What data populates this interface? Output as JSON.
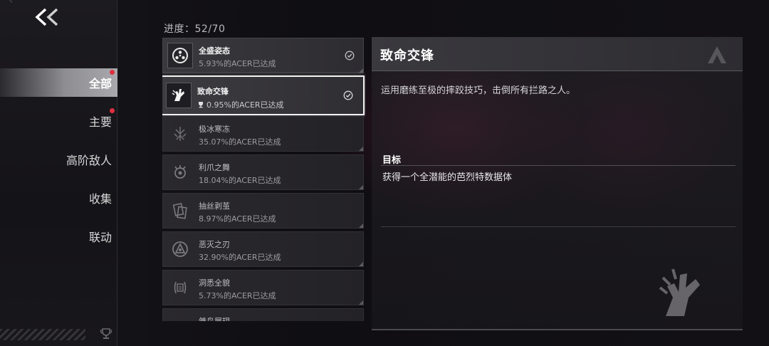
{
  "sidebar": {
    "items": [
      {
        "label": "全部",
        "active": true,
        "dot": true
      },
      {
        "label": "主要",
        "active": false,
        "dot": true
      },
      {
        "label": "高阶敌人",
        "active": false,
        "dot": false
      },
      {
        "label": "收集",
        "active": false,
        "dot": false
      },
      {
        "label": "联动",
        "active": false,
        "dot": false
      }
    ]
  },
  "progress": {
    "label": "进度：52/70"
  },
  "achievements": [
    {
      "title": "全盛姿态",
      "sub": "5.93%的ACER已达成",
      "icon": "emblem-ring-icon",
      "state": "done",
      "cup": false
    },
    {
      "title": "致命交锋",
      "sub": "0.95%的ACER已达成",
      "icon": "hand-grab-icon",
      "state": "selected",
      "cup": true
    },
    {
      "title": "极冰寒冻",
      "sub": "35.07%的ACER已达成",
      "icon": "ice-crystal-icon",
      "state": "locked",
      "cup": false
    },
    {
      "title": "利爪之舞",
      "sub": "18.04%的ACER已达成",
      "icon": "claw-icon",
      "state": "locked",
      "cup": false
    },
    {
      "title": "抽丝剥茧",
      "sub": "8.97%的ACER已达成",
      "icon": "cards-icon",
      "state": "locked",
      "cup": false
    },
    {
      "title": "恶灭之刃",
      "sub": "32.90%的ACER已达成",
      "icon": "blade-triangle-icon",
      "state": "locked",
      "cup": false
    },
    {
      "title": "洞悉全貌",
      "sub": "5.73%的ACER已达成",
      "icon": "scroll-icon",
      "state": "locked",
      "cup": false
    },
    {
      "title": "雏鸟展翅",
      "sub": "",
      "icon": "bird-icon",
      "state": "locked",
      "cup": false
    }
  ],
  "detail": {
    "title": "致命交锋",
    "description": "运用磨练至极的摔跤技巧，击倒所有拦路之人。",
    "goal_label": "目标",
    "goal_text": "获得一个全潜能的芭烈特数据体"
  },
  "colors": {
    "accent_dot": "#e0303f",
    "selected_border": "#f2f2f2"
  }
}
